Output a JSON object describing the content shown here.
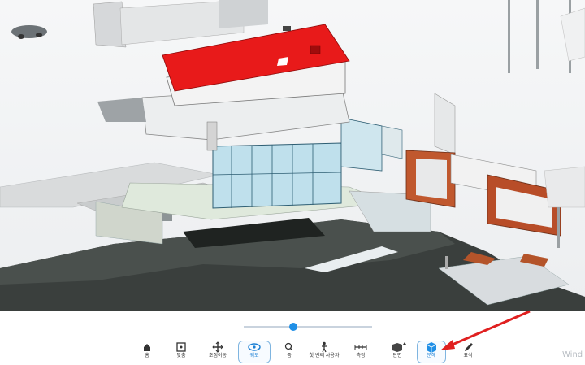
{
  "toolbar": {
    "items": [
      {
        "id": "home",
        "label": "홈",
        "icon": "home-icon"
      },
      {
        "id": "fit",
        "label": "맞춤",
        "icon": "fit-icon"
      },
      {
        "id": "pan",
        "label": "초점이동",
        "icon": "pan-icon"
      },
      {
        "id": "orbit",
        "label": "궤도",
        "icon": "orbit-icon",
        "active": true
      },
      {
        "id": "zoom",
        "label": "줌",
        "icon": "zoom-icon"
      },
      {
        "id": "first-person",
        "label": "첫 번째 사용자",
        "icon": "person-icon"
      },
      {
        "id": "measure",
        "label": "측정",
        "icon": "measure-icon"
      },
      {
        "id": "section",
        "label": "단면",
        "icon": "section-icon"
      },
      {
        "id": "explode",
        "label": "분해",
        "icon": "explode-icon",
        "active": true
      },
      {
        "id": "markup",
        "label": "표식",
        "icon": "markup-icon"
      }
    ]
  },
  "slider": {
    "value": 0.38
  },
  "watermark": "Wind",
  "colors": {
    "accent": "#1f8fe6",
    "roof": "#e81a1a",
    "arrow": "#e02020",
    "terrain": "#3a3f3d"
  }
}
